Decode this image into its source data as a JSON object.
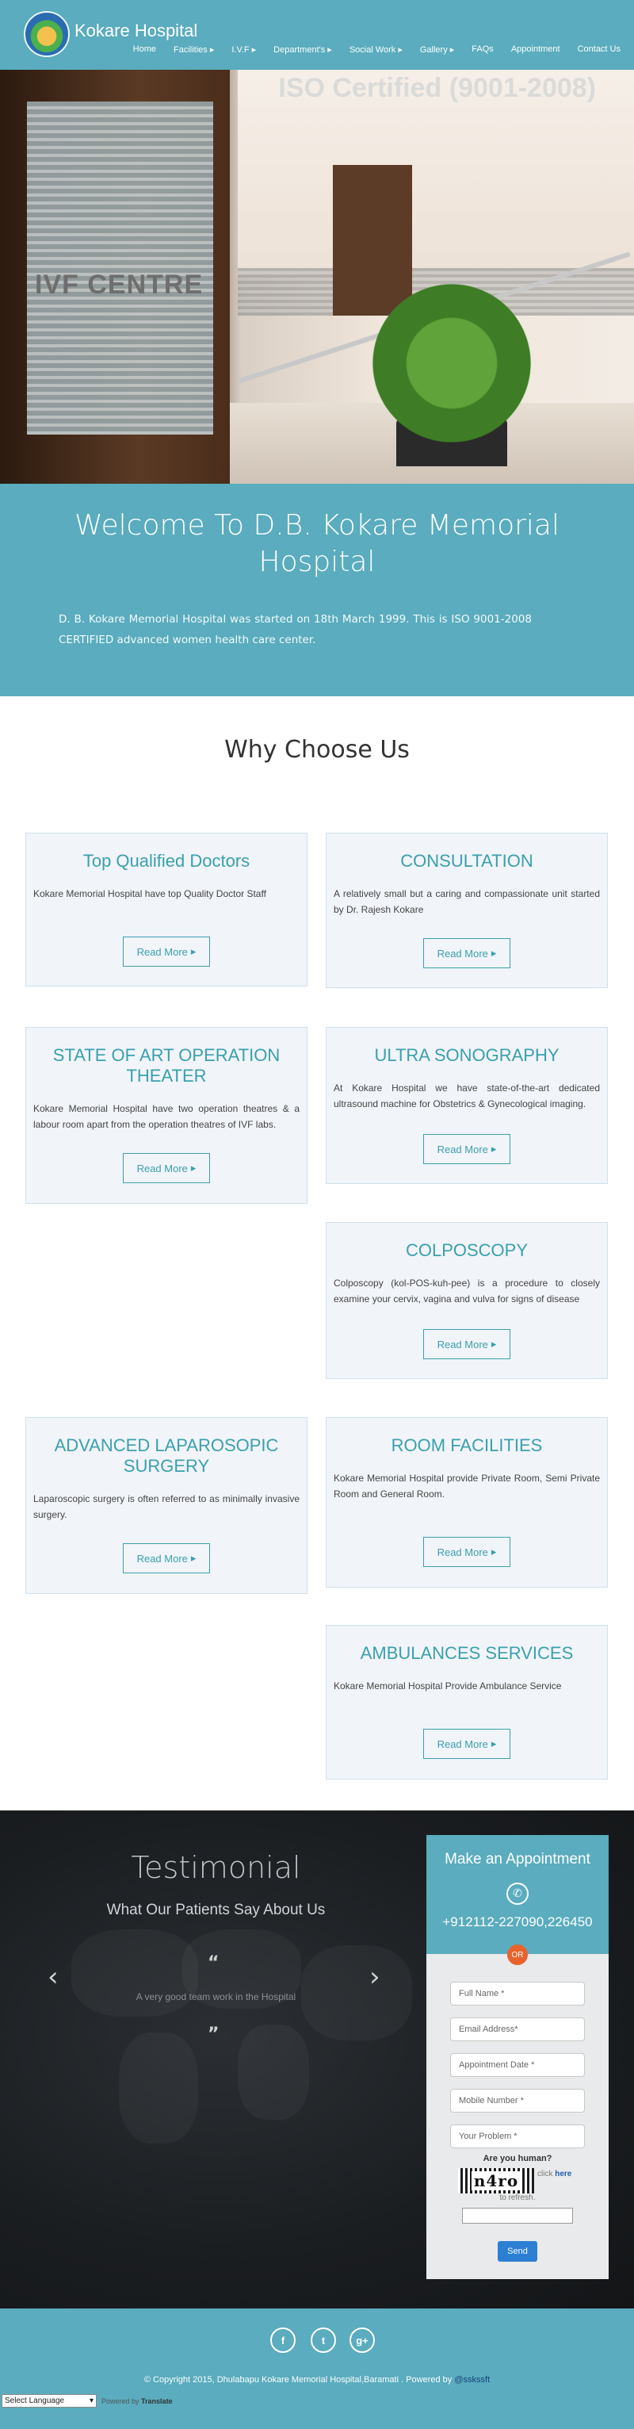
{
  "header": {
    "brand": "Kokare Hospital",
    "nav": [
      "Home",
      "Facilities ▸",
      "I.V.F ▸",
      "Department's ▸",
      "Social Work ▸",
      "Gallery ▸",
      "FAQs",
      "Appointment",
      "Contact Us"
    ]
  },
  "hero": {
    "iso_text": "ISO Certified (9001-2008)",
    "door_text": "IVF CENTRE"
  },
  "welcome": {
    "title": "Welcome To D.B. Kokare Memorial Hospital",
    "text": "D. B. Kokare Memorial Hospital was started on 18th March 1999. This is ISO 9001-2008 CERTIFIED advanced women health care center."
  },
  "why": {
    "title": "Why Choose Us",
    "read_more": "Read More",
    "cards": [
      {
        "title": "Top Qualified Doctors",
        "text": "Kokare Memorial Hospital have top Quality Doctor Staff"
      },
      {
        "title": "CONSULTATION",
        "text": "A relatively small but a caring and compassionate unit started by Dr. Rajesh Kokare"
      },
      {
        "title": "STATE OF ART OPERATION THEATER",
        "text": "Kokare Memorial Hospital have two operation theatres & a labour room apart from the operation theatres of IVF labs."
      },
      {
        "title": "ULTRA SONOGRAPHY",
        "text": "At Kokare Hospital we have state-of-the-art dedicated ultrasound machine for Obstetrics & Gynecological imaging."
      },
      {
        "title": "COLPOSCOPY",
        "text": "Colposcopy (kol-POS-kuh-pee) is a procedure to closely examine your cervix, vagina and vulva for signs of disease"
      },
      {
        "title": "ADVANCED LAPAROSOPIC SURGERY",
        "text": "Laparoscopic surgery is often referred to as minimally invasive surgery."
      },
      {
        "title": "ROOM FACILITIES",
        "text": "Kokare Memorial Hospital provide Private Room, Semi Private Room and General Room."
      },
      {
        "title": "AMBULANCES SERVICES",
        "text": "Kokare Memorial Hospital Provide Ambulance Service"
      }
    ]
  },
  "testimonial": {
    "title": "Testimonial",
    "subtitle": "What Our Patients Say About Us",
    "quote": "A very good team work in the Hospital"
  },
  "appointment": {
    "title": "Make an Appointment",
    "phone": "+912112-227090,226450",
    "or": "OR",
    "fields": [
      "Full Name *",
      "Email Address*",
      "Appointment Date *",
      "Mobile Number *",
      "Your Problem *"
    ],
    "human_label": "Are you human?",
    "captcha": "n4ro",
    "click_prefix": "click",
    "click_link": "here",
    "refresh": "to refresh.",
    "send": "Send"
  },
  "footer": {
    "social": [
      "f",
      "t",
      "g+"
    ],
    "copyright_prefix": "© Copyright 2015, Dhulabapu Kokare Memorial Hospital,Baramati . Powered by",
    "company": "@sskssft",
    "language": "Select Language",
    "powered_prefix": "Powered by",
    "powered_brand": "Translate"
  },
  "colors": {
    "accent": "#5aacbe",
    "card_title": "#3aa0ae",
    "or_badge": "#e8632b",
    "send_button": "#2c7fd3"
  }
}
